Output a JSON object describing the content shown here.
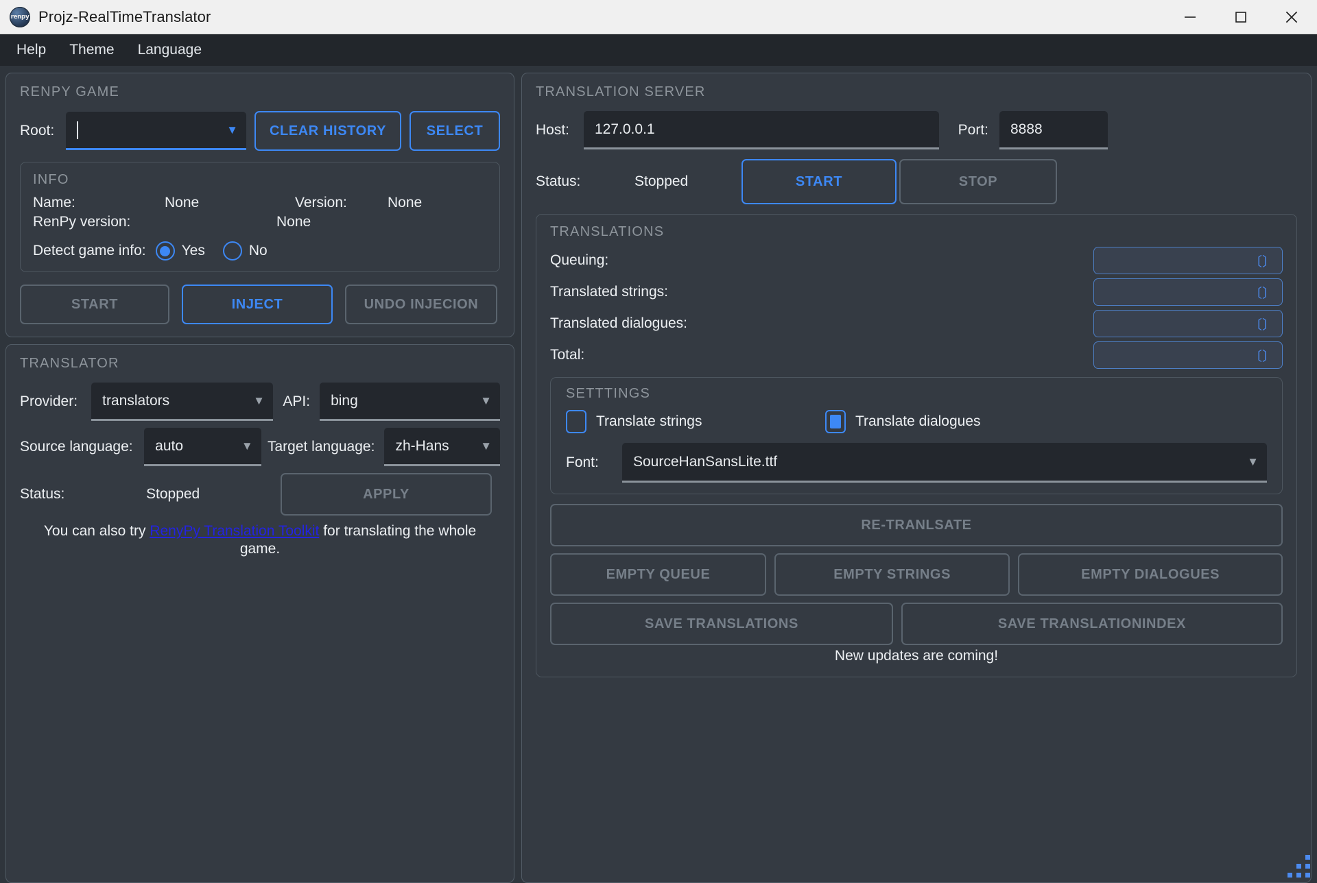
{
  "window": {
    "title": "Projz-RealTimeTranslator",
    "logo_text": "renpy",
    "minimize": "minimize-button",
    "maximize": "maximize-button",
    "close": "close-button"
  },
  "menubar": {
    "items": [
      "Help",
      "Theme",
      "Language"
    ]
  },
  "renpy_game": {
    "title": "RENPY GAME",
    "root_label": "Root:",
    "root_value": "",
    "clear_history": "CLEAR HISTORY",
    "select": "SELECT",
    "info": {
      "title": "INFO",
      "name_label": "Name:",
      "name_value": "None",
      "version_label": "Version:",
      "version_value": "None",
      "renpy_version_label": "RenPy version:",
      "renpy_version_value": "None",
      "detect_label": "Detect game info:",
      "yes": "Yes",
      "no": "No",
      "selected": "Yes"
    },
    "start": "START",
    "inject": "INJECT",
    "undo": "UNDO INJECION"
  },
  "translator": {
    "title": "TRANSLATOR",
    "provider_label": "Provider:",
    "provider_value": "translators",
    "api_label": "API:",
    "api_value": "bing",
    "source_label": "Source language:",
    "source_value": "auto",
    "target_label": "Target language:",
    "target_value": "zh-Hans",
    "status_label": "Status:",
    "status_value": "Stopped",
    "apply": "APPLY",
    "hint_prefix": "You can also try ",
    "hint_link": "RenyPy Translation Toolkit",
    "hint_suffix": " for translating the whole game."
  },
  "server": {
    "title": "TRANSLATION SERVER",
    "host_label": "Host:",
    "host_value": "127.0.0.1",
    "port_label": "Port:",
    "port_value": "8888",
    "status_label": "Status:",
    "status_value": "Stopped",
    "start": "START",
    "stop": "STOP"
  },
  "translations": {
    "title": "TRANSLATIONS",
    "rows": [
      {
        "label": "Queuing:",
        "value": ""
      },
      {
        "label": "Translated strings:",
        "value": ""
      },
      {
        "label": "Translated dialogues:",
        "value": ""
      },
      {
        "label": "Total:",
        "value": ""
      }
    ],
    "settings": {
      "title": "SETTTINGS",
      "translate_strings_label": "Translate strings",
      "translate_strings_checked": false,
      "translate_dialogues_label": "Translate dialogues",
      "translate_dialogues_checked": true,
      "font_label": "Font:",
      "font_value": "SourceHanSansLite.ttf"
    },
    "retranslate": "RE-TRANLSATE",
    "empty_queue": "EMPTY QUEUE",
    "empty_strings": "EMPTY STRINGS",
    "empty_dialogues": "EMPTY DIALOGUES",
    "save_translations": "SAVE TRANSLATIONS",
    "save_translationindex": "SAVE TRANSLATIONINDEX",
    "footer_note": "New updates are coming!"
  },
  "colors": {
    "accent": "#3d88f5",
    "disabled": "#767f89",
    "panel": "#343a42",
    "background": "#2f353c",
    "link": "#2323e0"
  }
}
